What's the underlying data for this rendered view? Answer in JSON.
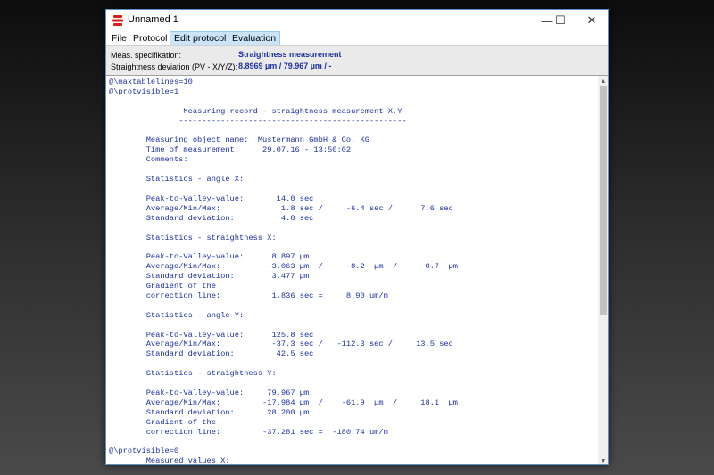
{
  "window": {
    "title": "Unnamed 1",
    "controls": {
      "minimize": "—",
      "maximize": "☐",
      "close": "✕"
    }
  },
  "menu": {
    "items": [
      {
        "label": "File",
        "highlighted": false
      },
      {
        "label": "Protocol",
        "highlighted": false
      },
      {
        "label": "Edit protocol",
        "highlighted": true
      },
      {
        "label": "Evaluation",
        "highlighted": true
      }
    ]
  },
  "info": {
    "spec_label": "Meas. specifikation:",
    "spec_value": "Straightness measurement",
    "dev_label": "Straightness deviation (PV - X/Y/Z):",
    "dev_value": "8.8969 µm / 79.967 µm / -"
  },
  "record": {
    "lines": [
      "@\\maxtablelines=10",
      "@\\protvisible=1",
      "",
      "                Measuring record - straightness measurement X,Y",
      "               -------------------------------------------------",
      "",
      "        Measuring object name:  Mustermann GmbH & Co. KG",
      "        Time of measurement:     29.07.16 - 13:50:02",
      "        Comments:",
      "",
      "        Statistics - angle X:",
      "",
      "        Peak-to-Valley-value:       14.0 sec",
      "        Average/Min/Max:             1.8 sec /     -6.4 sec /      7.6 sec",
      "        Standard deviation:          4.8 sec",
      "",
      "        Statistics - straightness X:",
      "",
      "        Peak-to-Valley-value:      8.897 µm",
      "        Average/Min/Max:          -3.063 µm  /     -8.2  µm  /      0.7  µm",
      "        Standard deviation:        3.477 µm",
      "        Gradient of the",
      "        correction line:           1.836 sec =     8.90 um/m",
      "",
      "        Statistics - angle Y:",
      "",
      "        Peak-to-Valley-value:      125.8 sec",
      "        Average/Min/Max:           -37.3 sec /   -112.3 sec /     13.5 sec",
      "        Standard deviation:         42.5 sec",
      "",
      "        Statistics - straightness Y:",
      "",
      "        Peak-to-Valley-value:     79.967 µm",
      "        Average/Min/Max:         -17.984 µm  /    -61.9  µm  /     18.1  µm",
      "        Standard deviation:       28.200 µm",
      "        Gradient of the",
      "        correction line:         -37.281 sec =  -180.74 um/m",
      "",
      "@\\protvisible=0",
      "        Measured values X:"
    ]
  },
  "scrollbar": {
    "position_fraction": 0.0,
    "visible_fraction": 0.62
  }
}
